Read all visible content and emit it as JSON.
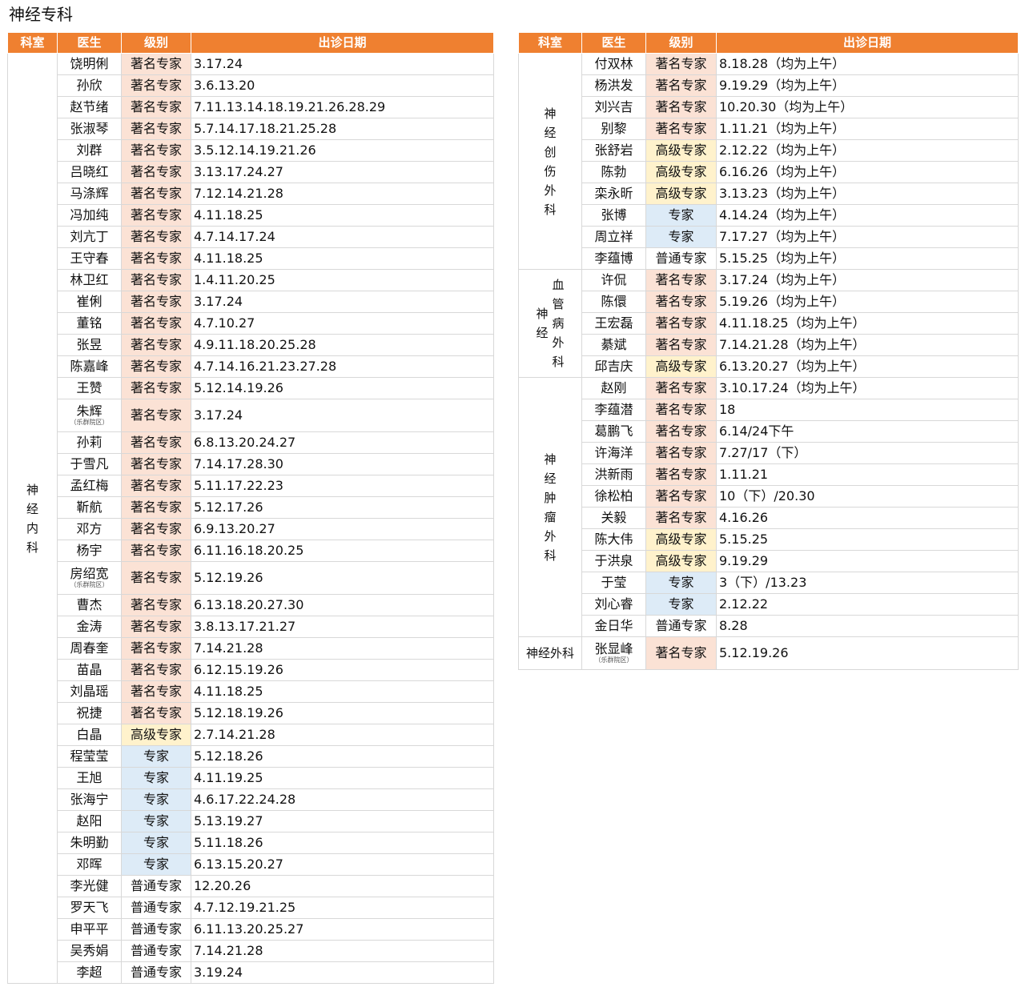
{
  "page_title": "神经专科",
  "headers": {
    "dept": "科室",
    "doctor": "医生",
    "level": "级别",
    "date": "出诊日期"
  },
  "left": {
    "groups": [
      {
        "dept": "神经内科",
        "rows": [
          {
            "doctor": "饶明俐",
            "level": "著名专家",
            "date": "3.17.24"
          },
          {
            "doctor": "孙欣",
            "level": "著名专家",
            "date": "3.6.13.20"
          },
          {
            "doctor": "赵节绪",
            "level": "著名专家",
            "date": "7.11.13.14.18.19.21.26.28.29"
          },
          {
            "doctor": "张淑琴",
            "level": "著名专家",
            "date": "5.7.14.17.18.21.25.28"
          },
          {
            "doctor": "刘群",
            "level": "著名专家",
            "date": "3.5.12.14.19.21.26"
          },
          {
            "doctor": "吕晓红",
            "level": "著名专家",
            "date": "3.13.17.24.27"
          },
          {
            "doctor": "马涤辉",
            "level": "著名专家",
            "date": "7.12.14.21.28"
          },
          {
            "doctor": "冯加纯",
            "level": "著名专家",
            "date": "4.11.18.25"
          },
          {
            "doctor": "刘亢丁",
            "level": "著名专家",
            "date": "4.7.14.17.24"
          },
          {
            "doctor": "王守春",
            "level": "著名专家",
            "date": "4.11.18.25"
          },
          {
            "doctor": "林卫红",
            "level": "著名专家",
            "date": "1.4.11.20.25"
          },
          {
            "doctor": "崔俐",
            "level": "著名专家",
            "date": "3.17.24"
          },
          {
            "doctor": "董铭",
            "level": "著名专家",
            "date": "4.7.10.27"
          },
          {
            "doctor": "张昱",
            "level": "著名专家",
            "date": "4.9.11.18.20.25.28"
          },
          {
            "doctor": "陈嘉峰",
            "level": "著名专家",
            "date": "4.7.14.16.21.23.27.28"
          },
          {
            "doctor": "王赞",
            "level": "著名专家",
            "date": "5.12.14.19.26"
          },
          {
            "doctor": "朱辉",
            "note": "（乐群院区）",
            "level": "著名专家",
            "date": "3.17.24"
          },
          {
            "doctor": "孙莉",
            "level": "著名专家",
            "date": "6.8.13.20.24.27"
          },
          {
            "doctor": "于雪凡",
            "level": "著名专家",
            "date": "7.14.17.28.30"
          },
          {
            "doctor": "孟红梅",
            "level": "著名专家",
            "date": "5.11.17.22.23"
          },
          {
            "doctor": "靳航",
            "level": "著名专家",
            "date": "5.12.17.26"
          },
          {
            "doctor": "邓方",
            "level": "著名专家",
            "date": "6.9.13.20.27"
          },
          {
            "doctor": "杨宇",
            "level": "著名专家",
            "date": "6.11.16.18.20.25"
          },
          {
            "doctor": "房绍宽",
            "note": "（乐群院区）",
            "level": "著名专家",
            "date": "5.12.19.26"
          },
          {
            "doctor": "曹杰",
            "level": "著名专家",
            "date": "6.13.18.20.27.30"
          },
          {
            "doctor": "金涛",
            "level": "著名专家",
            "date": "3.8.13.17.21.27"
          },
          {
            "doctor": "周春奎",
            "level": "著名专家",
            "date": "7.14.21.28"
          },
          {
            "doctor": "苗晶",
            "level": "著名专家",
            "date": "6.12.15.19.26"
          },
          {
            "doctor": "刘晶瑶",
            "level": "著名专家",
            "date": "4.11.18.25"
          },
          {
            "doctor": "祝捷",
            "level": "著名专家",
            "date": "5.12.18.19.26"
          },
          {
            "doctor": "白晶",
            "level": "高级专家",
            "date": "2.7.14.21.28"
          },
          {
            "doctor": "程莹莹",
            "level": "专家",
            "date": "5.12.18.26"
          },
          {
            "doctor": "王旭",
            "level": "专家",
            "date": "4.11.19.25"
          },
          {
            "doctor": "张海宁",
            "level": "专家",
            "date": "4.6.17.22.24.28"
          },
          {
            "doctor": "赵阳",
            "level": "专家",
            "date": "5.13.19.27"
          },
          {
            "doctor": "朱明勤",
            "level": "专家",
            "date": "5.11.18.26"
          },
          {
            "doctor": "邓晖",
            "level": "专家",
            "date": "6.13.15.20.27"
          },
          {
            "doctor": "李光健",
            "level": "普通专家",
            "date": "12.20.26"
          },
          {
            "doctor": "罗天飞",
            "level": "普通专家",
            "date": "4.7.12.19.21.25"
          },
          {
            "doctor": "申平平",
            "level": "普通专家",
            "date": "6.11.13.20.25.27"
          },
          {
            "doctor": "吴秀娟",
            "level": "普通专家",
            "date": "7.14.21.28"
          },
          {
            "doctor": "李超",
            "level": "普通专家",
            "date": "3.19.24"
          }
        ]
      }
    ]
  },
  "right": {
    "groups": [
      {
        "dept": "神经创伤外科",
        "rows": [
          {
            "doctor": "付双林",
            "level": "著名专家",
            "date": "8.18.28（均为上午）"
          },
          {
            "doctor": "杨洪发",
            "level": "著名专家",
            "date": "9.19.29（均为上午）"
          },
          {
            "doctor": "刘兴吉",
            "level": "著名专家",
            "date": "10.20.30（均为上午）"
          },
          {
            "doctor": "别黎",
            "level": "著名专家",
            "date": "1.11.21（均为上午）"
          },
          {
            "doctor": "张舒岩",
            "level": "高级专家",
            "date": "2.12.22（均为上午）"
          },
          {
            "doctor": "陈勃",
            "level": "高级专家",
            "date": "6.16.26（均为上午）"
          },
          {
            "doctor": "栾永昕",
            "level": "高级专家",
            "date": "3.13.23（均为上午）"
          },
          {
            "doctor": "张博",
            "level": "专家",
            "date": "4.14.24（均为上午）"
          },
          {
            "doctor": "周立祥",
            "level": "专家",
            "date": "7.17.27（均为上午）"
          },
          {
            "doctor": "李蕴博",
            "level": "普通专家",
            "date": "5.15.25（均为上午）"
          }
        ]
      },
      {
        "dept": "神经血管病外科",
        "rows": [
          {
            "doctor": "许侃",
            "level": "著名专家",
            "date": "3.17.24（均为上午）"
          },
          {
            "doctor": "陈儇",
            "level": "著名专家",
            "date": "5.19.26（均为上午）"
          },
          {
            "doctor": "王宏磊",
            "level": "著名专家",
            "date": "4.11.18.25（均为上午）"
          },
          {
            "doctor": "綦斌",
            "level": "著名专家",
            "date": "7.14.21.28（均为上午）"
          },
          {
            "doctor": "邱吉庆",
            "level": "高级专家",
            "date": "6.13.20.27（均为上午）"
          }
        ]
      },
      {
        "dept": "神经肿瘤外科",
        "rows": [
          {
            "doctor": "赵刚",
            "level": "著名专家",
            "date": "3.10.17.24（均为上午）"
          },
          {
            "doctor": "李蕴潜",
            "level": "著名专家",
            "date": "18"
          },
          {
            "doctor": "葛鹏飞",
            "level": "著名专家",
            "date": "6.14/24下午"
          },
          {
            "doctor": "许海洋",
            "level": "著名专家",
            "date": "7.27/17（下）"
          },
          {
            "doctor": "洪新雨",
            "level": "著名专家",
            "date": "1.11.21"
          },
          {
            "doctor": "徐松柏",
            "level": "著名专家",
            "date": "10（下）/20.30"
          },
          {
            "doctor": "关毅",
            "level": "著名专家",
            "date": "4.16.26"
          },
          {
            "doctor": "陈大伟",
            "level": "高级专家",
            "date": "5.15.25"
          },
          {
            "doctor": "于洪泉",
            "level": "高级专家",
            "date": "9.19.29"
          },
          {
            "doctor": "于莹",
            "level": "专家",
            "date": "3（下）/13.23"
          },
          {
            "doctor": "刘心睿",
            "level": "专家",
            "date": "2.12.22"
          },
          {
            "doctor": "金日华",
            "level": "普通专家",
            "date": "8.28"
          }
        ]
      },
      {
        "dept": "神经外科",
        "rows": [
          {
            "doctor": "张显峰",
            "note": "（乐群院区）",
            "level": "著名专家",
            "date": "5.12.19.26"
          }
        ]
      }
    ]
  }
}
